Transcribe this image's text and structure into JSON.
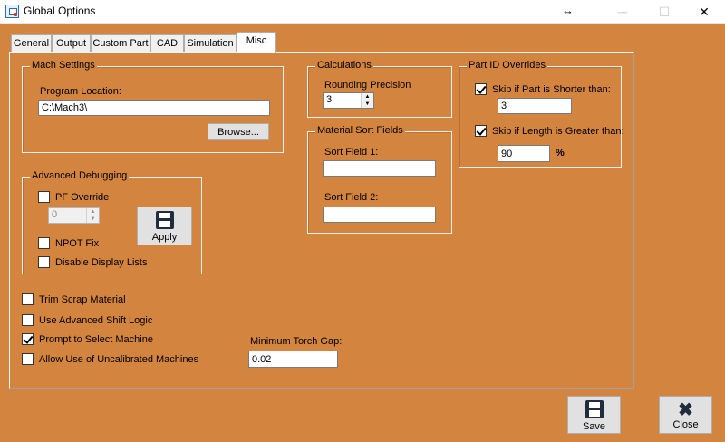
{
  "window": {
    "title": "Global Options",
    "resize_glyph": "↔",
    "minimize": "─",
    "maximize": "☐",
    "close": "✕"
  },
  "tabs": [
    {
      "label": "General"
    },
    {
      "label": "Output"
    },
    {
      "label": "Custom Part"
    },
    {
      "label": "CAD"
    },
    {
      "label": "Simulation"
    },
    {
      "label": "Misc",
      "active": true
    }
  ],
  "mach_settings": {
    "title": "Mach Settings",
    "program_location_label": "Program Location:",
    "program_location_value": "C:\\Mach3\\",
    "browse_label": "Browse..."
  },
  "calculations": {
    "title": "Calculations",
    "rounding_precision_label": "Rounding Precision",
    "rounding_precision_value": "3"
  },
  "part_id_overrides": {
    "title": "Part ID Overrides",
    "skip_shorter_label": "Skip if Part is Shorter than:",
    "skip_shorter_checked": true,
    "skip_shorter_value": "3",
    "skip_longer_label": "Skip if Length is Greater than:",
    "skip_longer_checked": true,
    "skip_longer_value": "90",
    "percent_sign": "%"
  },
  "material_sort": {
    "title": "Material Sort Fields",
    "sort_field_1_label": "Sort Field 1:",
    "sort_field_1_value": "",
    "sort_field_2_label": "Sort Field 2:",
    "sort_field_2_value": ""
  },
  "advanced_debugging": {
    "title": "Advanced Debugging",
    "pf_override_label": "PF Override",
    "pf_override_checked": false,
    "pf_override_value": "0",
    "apply_label": "Apply",
    "npot_fix_label": "NPOT Fix",
    "npot_fix_checked": false,
    "disable_display_lists_label": "Disable Display Lists",
    "disable_display_lists_checked": false
  },
  "options": {
    "trim_scrap_label": "Trim Scrap Material",
    "trim_scrap_checked": false,
    "advanced_shift_label": "Use Advanced Shift Logic",
    "advanced_shift_checked": false,
    "prompt_machine_label": "Prompt to Select Machine",
    "prompt_machine_checked": true,
    "uncalibrated_label": "Allow Use of Uncalibrated Machines",
    "uncalibrated_checked": false
  },
  "torch_gap": {
    "label": "Minimum Torch Gap:",
    "value": "0.02"
  },
  "footer": {
    "save_label": "Save",
    "close_label": "Close"
  },
  "colors": {
    "background": "#d3853f",
    "titlebar": "#ffffff"
  }
}
